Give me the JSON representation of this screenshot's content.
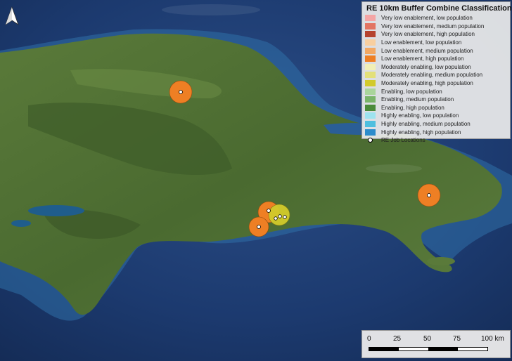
{
  "legend": {
    "title": "RE 10km Buffer Combine Classification",
    "items": [
      {
        "label": "Very low enablement, low population",
        "color": "#f4a5a5"
      },
      {
        "label": "Very low enablement, medium population",
        "color": "#e27462"
      },
      {
        "label": "Very low enablement, high population",
        "color": "#b5432f"
      },
      {
        "label": "Low enablement, low population",
        "color": "#f8cfa0"
      },
      {
        "label": "Low enablement, medium population",
        "color": "#f3a863"
      },
      {
        "label": "Low enablement, high population",
        "color": "#ee7f24"
      },
      {
        "label": "Moderately enabling, low population",
        "color": "#f1efb6"
      },
      {
        "label": "Moderately enabling, medium population",
        "color": "#e3e07a"
      },
      {
        "label": "Moderately enabling, high population",
        "color": "#d2ca2b"
      },
      {
        "label": "Enabling, low population",
        "color": "#aad59b"
      },
      {
        "label": "Enabling, medium population",
        "color": "#7ab46a"
      },
      {
        "label": "Enabling, high population",
        "color": "#4a8a3a"
      },
      {
        "label": "Highly enabling, low population",
        "color": "#9de3ef"
      },
      {
        "label": "Highly enabling, medium population",
        "color": "#4fbfdf"
      },
      {
        "label": "Highly enabling, high population",
        "color": "#2c8ccb"
      }
    ],
    "job_locations_label": "RE Job Locations"
  },
  "scale_bar": {
    "labels": [
      "0",
      "25",
      "50",
      "75",
      "100 km"
    ]
  },
  "north_arrow": {
    "icon": "north-arrow-icon"
  },
  "colors": {
    "ocean": "#1b3567",
    "shallow_water": "#2f6fa8",
    "land": "#4f6d33",
    "buffer_orange": "#ee7f24",
    "buffer_yellow": "#d2ca2b"
  }
}
